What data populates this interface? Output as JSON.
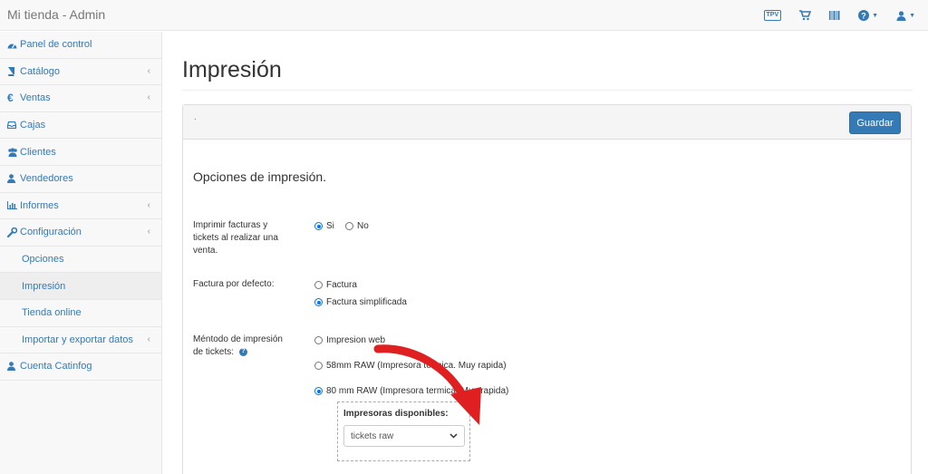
{
  "topbar": {
    "brand": "Mi tienda - Admin",
    "tpv_label": "TPV",
    "icons": [
      "tpv-icon",
      "cart-icon",
      "barcode-icon",
      "help-icon",
      "user-icon"
    ]
  },
  "sidebar": {
    "items": [
      {
        "label": "Panel de control",
        "icon": "dashboard-icon"
      },
      {
        "label": "Catálogo",
        "icon": "book-icon"
      },
      {
        "label": "Ventas",
        "icon": "euro-icon"
      },
      {
        "label": "Cajas",
        "icon": "inbox-icon"
      },
      {
        "label": "Clientes",
        "icon": "users-icon"
      },
      {
        "label": "Vendedores",
        "icon": "user-icon"
      },
      {
        "label": "Informes",
        "icon": "bar-chart-icon"
      },
      {
        "label": "Configuración",
        "icon": "wrench-icon"
      }
    ],
    "sub_items": [
      {
        "label": "Opciones"
      },
      {
        "label": "Impresión"
      },
      {
        "label": "Tienda online"
      },
      {
        "label": "Importar y exportar datos"
      }
    ],
    "account": {
      "label": "Cuenta Catinfog",
      "icon": "user-icon"
    }
  },
  "main": {
    "page_title": "Impresión",
    "panel_dot": ".",
    "save_label": "Guardar",
    "section_title": "Opciones de impresión.",
    "print_on_sale": {
      "label": "Imprimir facturas y tickets al realizar una venta.",
      "options": [
        "Si",
        "No"
      ],
      "selected": "Si"
    },
    "default_invoice": {
      "label": "Factura por defecto:",
      "options": [
        "Factura",
        "Factura simplificada"
      ],
      "selected": "Factura simplificada"
    },
    "ticket_method": {
      "label": "Méntodo de impresión de tickets:",
      "options": [
        "Impresion web",
        "58mm RAW (Impresora termica. Muy rapida)",
        "80 mm RAW (Impresora termica. Muy rapida)"
      ],
      "selected": "80 mm RAW (Impresora termica. Muy rapida)"
    },
    "printers": {
      "label": "Impresoras disponibles:",
      "selected": "tickets raw"
    }
  },
  "colors": {
    "accent": "#337ab7",
    "arrow": "#e02020"
  }
}
